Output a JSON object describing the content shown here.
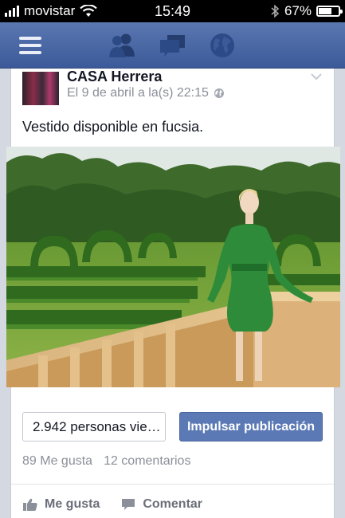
{
  "status_bar": {
    "carrier": "movistar",
    "time": "15:49",
    "battery_text": "67%",
    "battery_level": 0.67
  },
  "nav": {
    "icons": [
      "menu-icon",
      "friends-icon",
      "messages-icon",
      "globe-icon"
    ]
  },
  "post": {
    "page_name": "CASA Herrera",
    "timestamp": "El 9 de abril a la(s) 22:15",
    "text": "Vestido disponible en fucsia.",
    "views": "2.942 personas vie…",
    "boost_label": "Impulsar publicación",
    "likes": "89 Me gusta",
    "comments": "12 comentarios",
    "like_label": "Me gusta",
    "comment_label": "Comentar"
  },
  "colors": {
    "fb_blue": "#3c5a99",
    "boost_button": "#5b79b5",
    "dress_green": "#2e8b3a"
  }
}
